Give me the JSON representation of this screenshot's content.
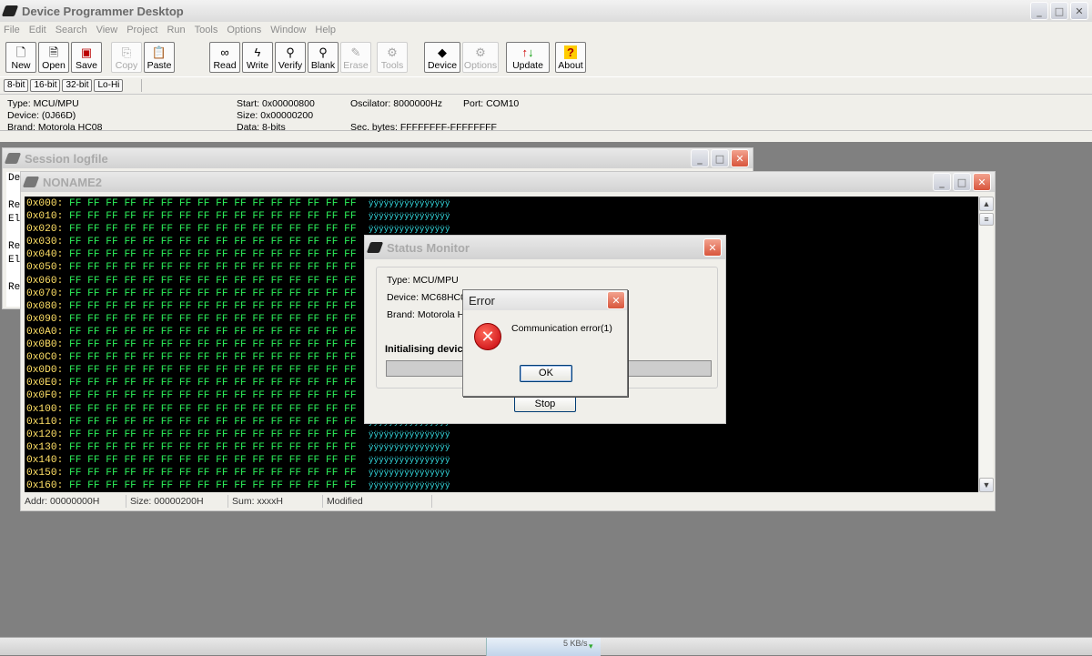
{
  "app": {
    "title": "Device Programmer Desktop",
    "menu": [
      "File",
      "Edit",
      "Search",
      "View",
      "Project",
      "Run",
      "Tools",
      "Options",
      "Window",
      "Help"
    ]
  },
  "toolbar": {
    "buttons": [
      {
        "label": "New",
        "icon": "new-doc-icon",
        "enabled": true
      },
      {
        "label": "Open",
        "icon": "open-icon",
        "enabled": true
      },
      {
        "label": "Save",
        "icon": "save-icon",
        "enabled": true
      },
      {
        "label": "Copy",
        "icon": "copy-icon",
        "enabled": false
      },
      {
        "label": "Paste",
        "icon": "paste-icon",
        "enabled": true
      },
      {
        "label": "Read",
        "icon": "glasses-icon",
        "enabled": true
      },
      {
        "label": "Write",
        "icon": "lightning-icon",
        "enabled": true
      },
      {
        "label": "Verify",
        "icon": "magnifier-icon",
        "enabled": true
      },
      {
        "label": "Blank",
        "icon": "blank-check-icon",
        "enabled": true
      },
      {
        "label": "Erase",
        "icon": "eraser-icon",
        "enabled": false
      },
      {
        "label": "Tools",
        "icon": "tools-icon",
        "enabled": false
      },
      {
        "label": "Device",
        "icon": "chip-icon",
        "enabled": true
      },
      {
        "label": "Options",
        "icon": "options-icon",
        "enabled": false
      },
      {
        "label": "Update",
        "icon": "update-arrows-icon",
        "enabled": true
      },
      {
        "label": "About",
        "icon": "question-icon",
        "enabled": true
      }
    ],
    "word_modes": [
      "8-bit",
      "16-bit",
      "32-bit",
      "Lo-Hi"
    ]
  },
  "info": {
    "type": "Type: MCU/MPU",
    "device": "Device: (0J66D)",
    "brand": "Brand: Motorola HC08",
    "start": "Start: 0x00000800",
    "size": "Size: 0x00000200",
    "data": "Data: 8-bits",
    "oscilator": "Oscilator: 8000000Hz",
    "port": "Port: COM10",
    "sec_bytes": "Sec. bytes: FFFFFFFF-FFFFFFFF"
  },
  "session": {
    "title": "Session logfile",
    "lines": [
      "De",
      "",
      "Re",
      "El",
      "",
      "Re",
      "El",
      "",
      "Re"
    ]
  },
  "editor": {
    "title": "NONAME2",
    "addresses": [
      "0x000:",
      "0x010:",
      "0x020:",
      "0x030:",
      "0x040:",
      "0x050:",
      "0x060:",
      "0x070:",
      "0x080:",
      "0x090:",
      "0x0A0:",
      "0x0B0:",
      "0x0C0:",
      "0x0D0:",
      "0x0E0:",
      "0x0F0:",
      "0x100:",
      "0x110:",
      "0x120:",
      "0x130:",
      "0x140:",
      "0x150:",
      "0x160:"
    ],
    "hex_bytes": "FF FF FF FF FF FF FF FF FF FF FF FF FF FF FF FF",
    "ascii": "ÿÿÿÿÿÿÿÿÿÿÿÿÿÿÿÿ",
    "status": {
      "addr": "Addr: 00000000H",
      "size": "Size: 00000200H",
      "sum": "Sum: xxxxH",
      "modified": "Modified"
    }
  },
  "monitor": {
    "title": "Status Monitor",
    "type": "Type: MCU/MPU",
    "device": "Device: MC68HC0",
    "brand": "Brand: Motorola HC",
    "initialising": "Initialising devic",
    "stop_label": "Stop"
  },
  "error": {
    "title": "Error",
    "message": "Communication error(1)",
    "ok_label": "OK"
  },
  "taskbar": {
    "speed": "5 KB/s"
  }
}
